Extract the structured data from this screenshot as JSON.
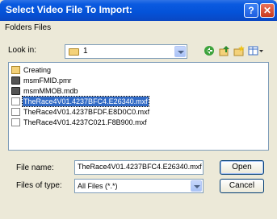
{
  "window": {
    "title": "Select Video File To Import:"
  },
  "titlebar": {
    "help": "?",
    "close": "✕"
  },
  "menu": {
    "folders": "Folders",
    "files": "Files"
  },
  "lookin": {
    "label": "Look in:",
    "value": "1"
  },
  "files": [
    {
      "name": "Creating",
      "type": "folder",
      "selected": false
    },
    {
      "name": "msmFMID.pmr",
      "type": "database",
      "selected": false
    },
    {
      "name": "msmMMOB.mdb",
      "type": "database",
      "selected": false
    },
    {
      "name": "TheRace4V01.4237BFC4.E26340.mxf",
      "type": "file",
      "selected": true
    },
    {
      "name": "TheRace4V01.4237BFDF.E8D0C0.mxf",
      "type": "file",
      "selected": false
    },
    {
      "name": "TheRace4V01.4237C021.F8B900.mxf",
      "type": "file",
      "selected": false
    }
  ],
  "filename": {
    "label": "File name:",
    "value": "TheRace4V01.4237BFC4.E26340.mxf"
  },
  "filetype": {
    "label": "Files of type:",
    "value": "All Files (*.*)"
  },
  "buttons": {
    "open": "Open",
    "cancel": "Cancel"
  },
  "colors": {
    "title_bar": "#0452d8",
    "selection": "#316ac5",
    "dialog_bg": "#ece9d8"
  }
}
